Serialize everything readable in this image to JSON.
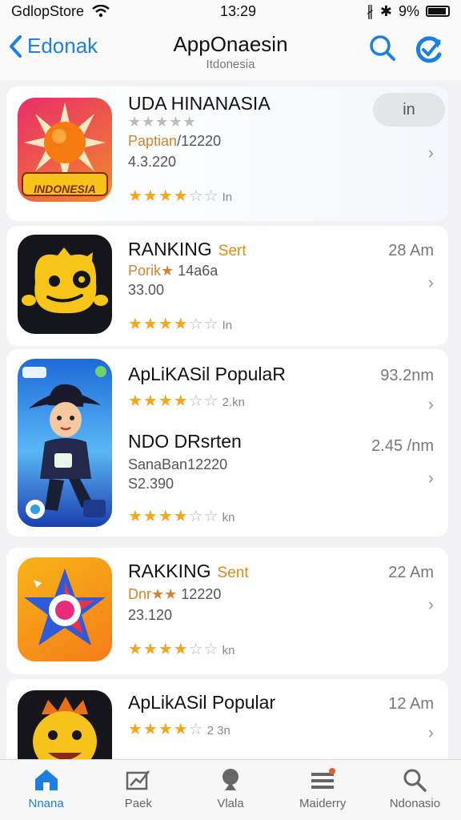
{
  "status": {
    "carrier": "GdlopStore",
    "time": "13:29",
    "battery": "9%"
  },
  "nav": {
    "back_label": "Edonak",
    "title": "AppOnaesin",
    "subtitle": "Itdonesia"
  },
  "apps": [
    {
      "name": "UDA HINANASIA",
      "rating_line": "★★★★★",
      "meta1_prefix": "Paptian",
      "meta1": "/12220",
      "meta2": "4.3.220",
      "stars_filled": 4,
      "stars_count": "In",
      "action": "in",
      "icon_text": "INDONESIA",
      "icon_theme": "sun"
    },
    {
      "name": "RANKING",
      "tag": "Sert",
      "meta1_prefix": "Porik★",
      "meta1": "14a6a",
      "meta2": "33.00",
      "stars_filled": 4,
      "stars_count": "In",
      "time": "28 Am",
      "icon_theme": "monster"
    },
    {
      "name": "ApLiKASil PopulaR",
      "stars_filled": 4,
      "stars_count": "2.kn",
      "time": "93.2nm",
      "icon_theme": "ninja"
    },
    {
      "name": "NDO DRsrten",
      "meta1": "SanaBan12220",
      "meta2": "S2.390",
      "stars_filled": 4,
      "stars_count": "kn",
      "time": "2.45 /nm"
    },
    {
      "name": "RAKKING",
      "tag": "Sent",
      "meta1_prefix": "Dnr★★",
      "meta1": "12220",
      "meta2": "23.120",
      "stars_filled": 4,
      "stars_count": "kn",
      "time": "22 Am",
      "icon_theme": "star"
    },
    {
      "name": "ApLikASil Popular",
      "stars_filled": 4,
      "stars_count": "2 3n",
      "time": "12 Am",
      "icon_theme": "lion"
    }
  ],
  "tabs": [
    {
      "label": "Nnana",
      "icon": "home-icon",
      "active": true
    },
    {
      "label": "Paek",
      "icon": "chart-icon"
    },
    {
      "label": "Vlala",
      "icon": "person-icon"
    },
    {
      "label": "Maiderry",
      "icon": "list-icon"
    },
    {
      "label": "Ndonasio",
      "icon": "search-icon"
    }
  ],
  "colors": {
    "accent": "#1d7fe0",
    "star": "#f2a71b",
    "tag": "#e08a12"
  }
}
